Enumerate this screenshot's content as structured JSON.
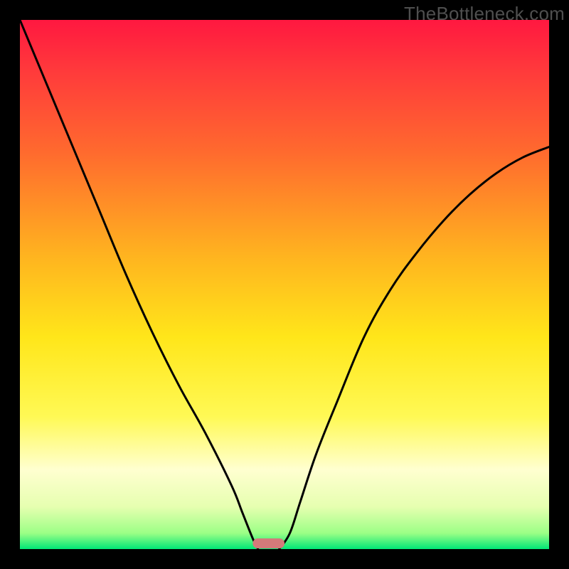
{
  "watermark": "TheBottleneck.com",
  "chart_data": {
    "type": "line",
    "title": "",
    "xlabel": "",
    "ylabel": "",
    "xlim": [
      0,
      100
    ],
    "ylim": [
      0,
      100
    ],
    "background": {
      "type": "vertical-gradient",
      "stops": [
        {
          "offset": 0.0,
          "color": "#ff1840"
        },
        {
          "offset": 0.1,
          "color": "#ff3b3b"
        },
        {
          "offset": 0.25,
          "color": "#ff6a2e"
        },
        {
          "offset": 0.45,
          "color": "#ffb51f"
        },
        {
          "offset": 0.6,
          "color": "#ffe61a"
        },
        {
          "offset": 0.75,
          "color": "#fff955"
        },
        {
          "offset": 0.85,
          "color": "#ffffd0"
        },
        {
          "offset": 0.92,
          "color": "#e6ffb0"
        },
        {
          "offset": 0.97,
          "color": "#9bff86"
        },
        {
          "offset": 1.0,
          "color": "#00e676"
        }
      ]
    },
    "series": [
      {
        "name": "left-curve",
        "x": [
          0,
          5,
          10,
          15,
          20,
          25,
          30,
          35,
          40,
          42,
          44,
          45
        ],
        "y": [
          100,
          88,
          76,
          64,
          52,
          41,
          31,
          22,
          12,
          7,
          2,
          0
        ]
      },
      {
        "name": "right-curve",
        "x": [
          49,
          51,
          53,
          56,
          60,
          65,
          70,
          75,
          80,
          85,
          90,
          95,
          100
        ],
        "y": [
          0,
          3,
          9,
          18,
          28,
          40,
          49,
          56,
          62,
          67,
          71,
          74,
          76
        ]
      }
    ],
    "marker": {
      "name": "bottleneck-marker",
      "x": 47,
      "width": 6,
      "color": "#d47a7a"
    }
  }
}
